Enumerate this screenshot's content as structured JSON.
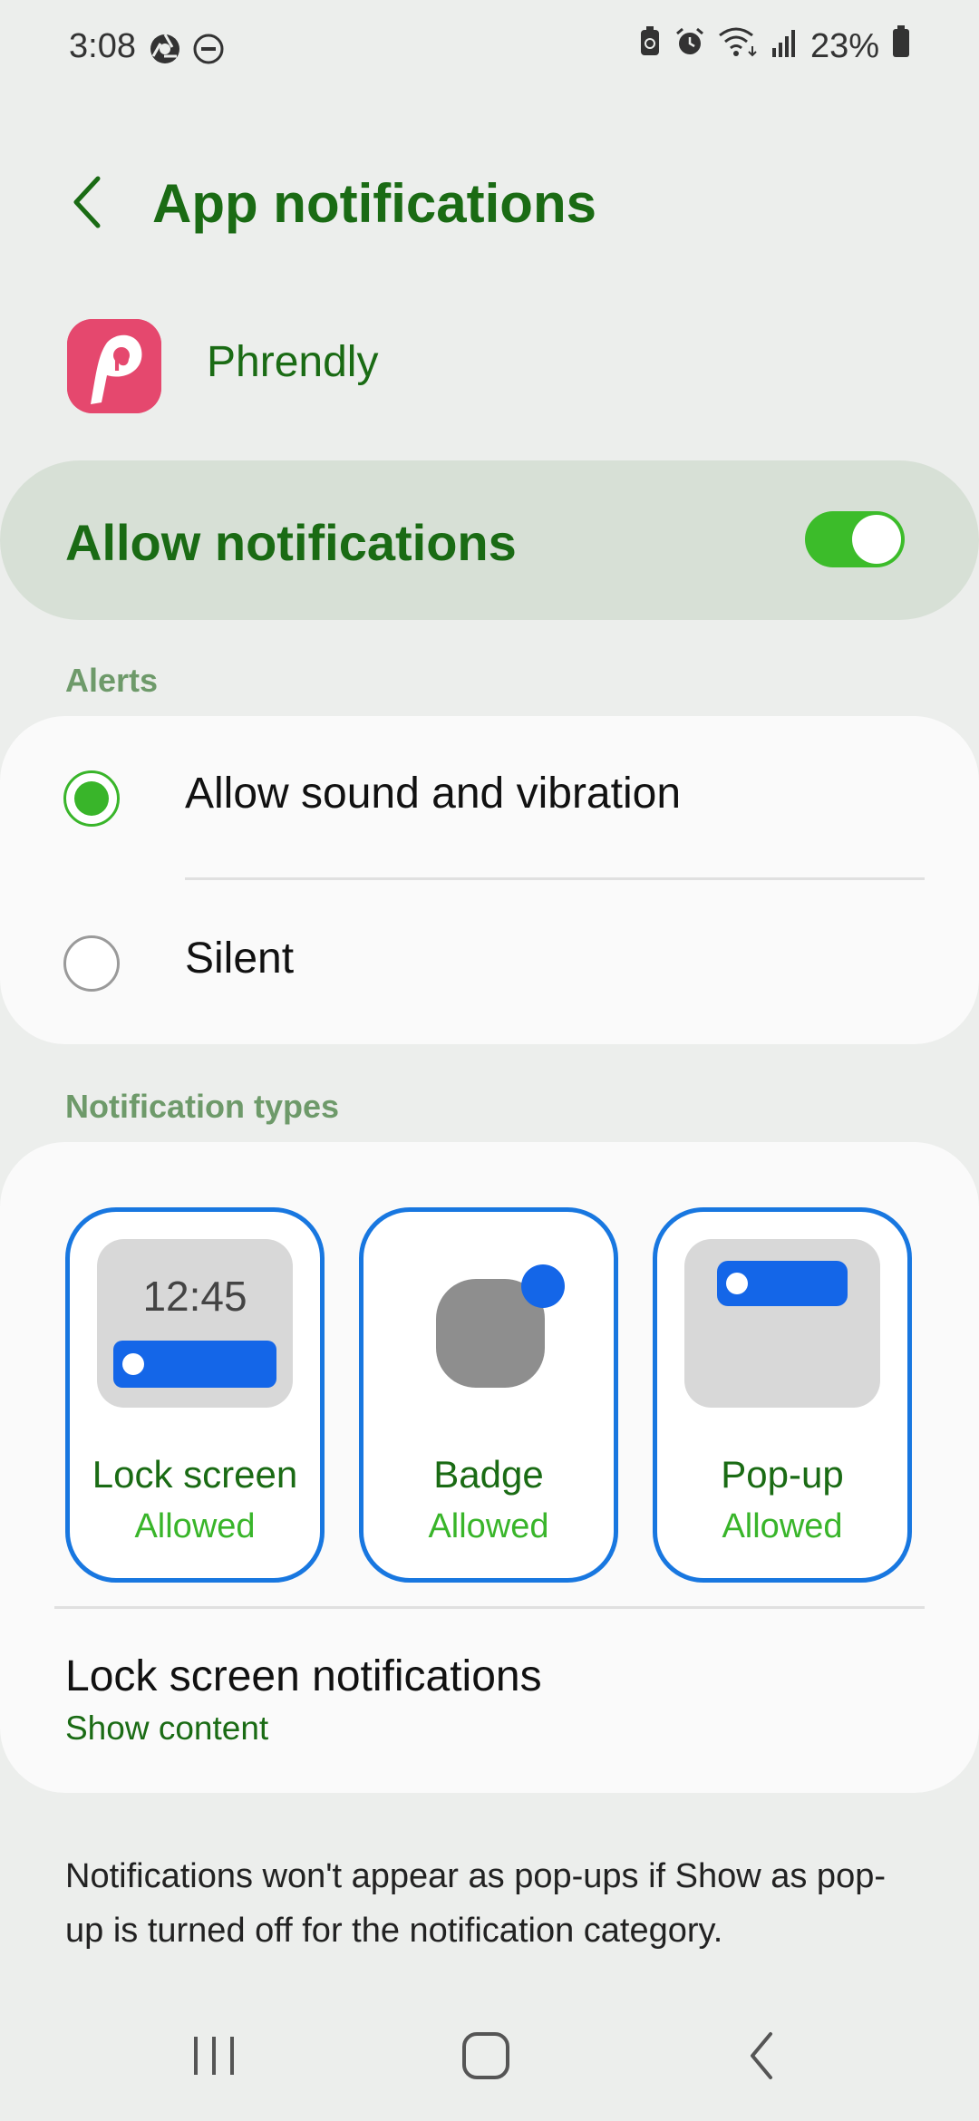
{
  "status_bar": {
    "time": "3:08",
    "battery": "23%"
  },
  "header": {
    "title": "App notifications"
  },
  "app": {
    "name": "Phrendly",
    "icon": "phrendly-logo",
    "logo_letter": "p"
  },
  "allow_notifications": {
    "label": "Allow notifications",
    "enabled": true
  },
  "alerts": {
    "header": "Alerts",
    "options": [
      {
        "label": "Allow sound and vibration",
        "selected": true
      },
      {
        "label": "Silent",
        "selected": false
      }
    ]
  },
  "notification_types": {
    "header": "Notification types",
    "items": [
      {
        "title": "Lock screen",
        "status": "Allowed",
        "preview_time": "12:45"
      },
      {
        "title": "Badge",
        "status": "Allowed"
      },
      {
        "title": "Pop-up",
        "status": "Allowed"
      }
    ]
  },
  "lock_screen_notifications": {
    "title": "Lock screen notifications",
    "value": "Show content"
  },
  "footer_note": "Notifications won't appear as pop-ups if Show as pop-up is turned off for the notification category.",
  "colors": {
    "accent_green": "#1a6b14",
    "toggle_on": "#3cbc2a",
    "selection_blue": "#1877e0"
  }
}
